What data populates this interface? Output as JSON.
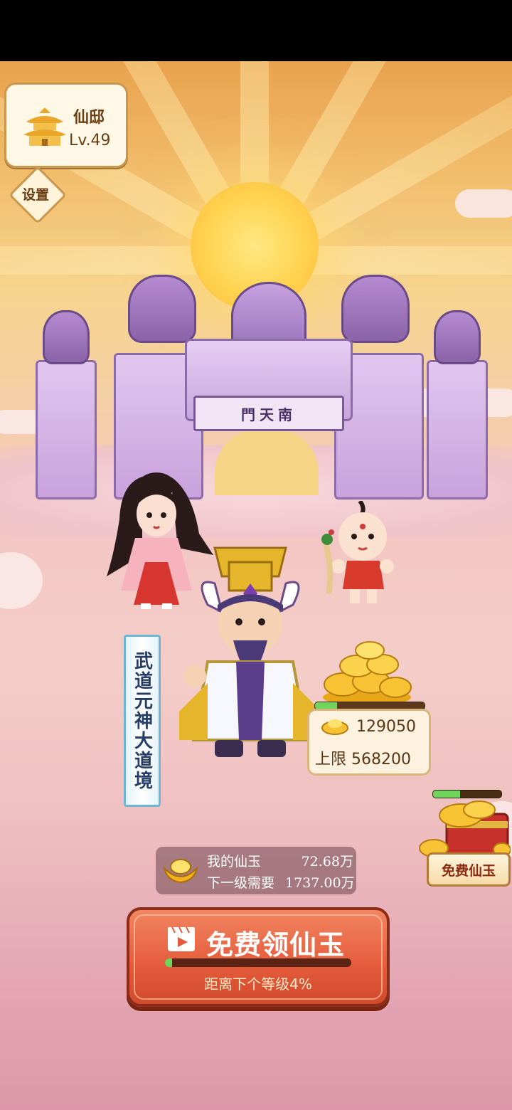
{
  "level_card": {
    "title": "仙邸",
    "level": "Lv.49"
  },
  "settings": {
    "label": "设置"
  },
  "gate": {
    "plaque": "門天南"
  },
  "realm_banner": {
    "text": "武道元神大道境"
  },
  "treasury": {
    "amount": "129050",
    "cap": "上限 568200",
    "fill_fraction": 0.2
  },
  "free_jade": {
    "label": "免费仙玉",
    "fill_fraction": 0.4
  },
  "jade": {
    "mine_label": "我的仙玉",
    "mine_value": "72.68万",
    "next_label": "下一级需要",
    "next_value": "1737.00万"
  },
  "claim": {
    "label": "免费领仙玉",
    "subtitle": "距离下个等级4%",
    "progress": 0.04
  },
  "colors": {
    "accent": "#e45b3b",
    "progress": "#6ed45a",
    "gold": "#f7c233"
  },
  "icons": [
    "temple-icon",
    "video-icon",
    "gold-ingot-icon",
    "treasure-chest-icon"
  ]
}
